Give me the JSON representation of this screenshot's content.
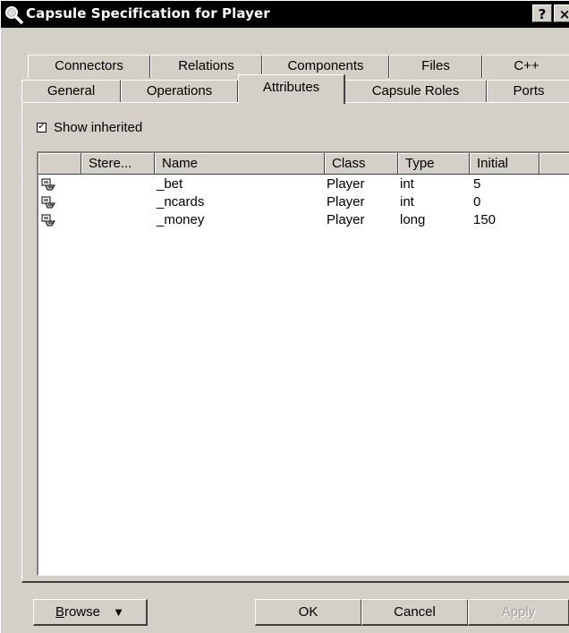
{
  "window": {
    "title": "Capsule Specification for Player",
    "help_label": "?",
    "close_label": "×"
  },
  "tabs_row1": [
    "Connectors",
    "Relations",
    "Components",
    "Files",
    "C++"
  ],
  "tabs_row2": [
    "General",
    "Operations",
    "Attributes",
    "Capsule Roles",
    "Ports"
  ],
  "active_tab": "Attributes",
  "show_inherited": {
    "label": "Show inherited",
    "checked": true
  },
  "table": {
    "columns": [
      "",
      "Stere...",
      "Name",
      "Class",
      "Type",
      "Initial"
    ],
    "rows": [
      {
        "icon": "attribute-icon",
        "stereotype": "",
        "name": "_bet",
        "class": "Player",
        "type": "int",
        "initial": "5"
      },
      {
        "icon": "attribute-icon",
        "stereotype": "",
        "name": "_ncards",
        "class": "Player",
        "type": "int",
        "initial": "0"
      },
      {
        "icon": "attribute-icon",
        "stereotype": "",
        "name": "_money",
        "class": "Player",
        "type": "long",
        "initial": "150"
      }
    ]
  },
  "buttons": {
    "browse_first": "B",
    "browse_rest": "rowse",
    "browse_arrow": "▼",
    "ok": "OK",
    "cancel": "Cancel",
    "apply": "Apply"
  }
}
